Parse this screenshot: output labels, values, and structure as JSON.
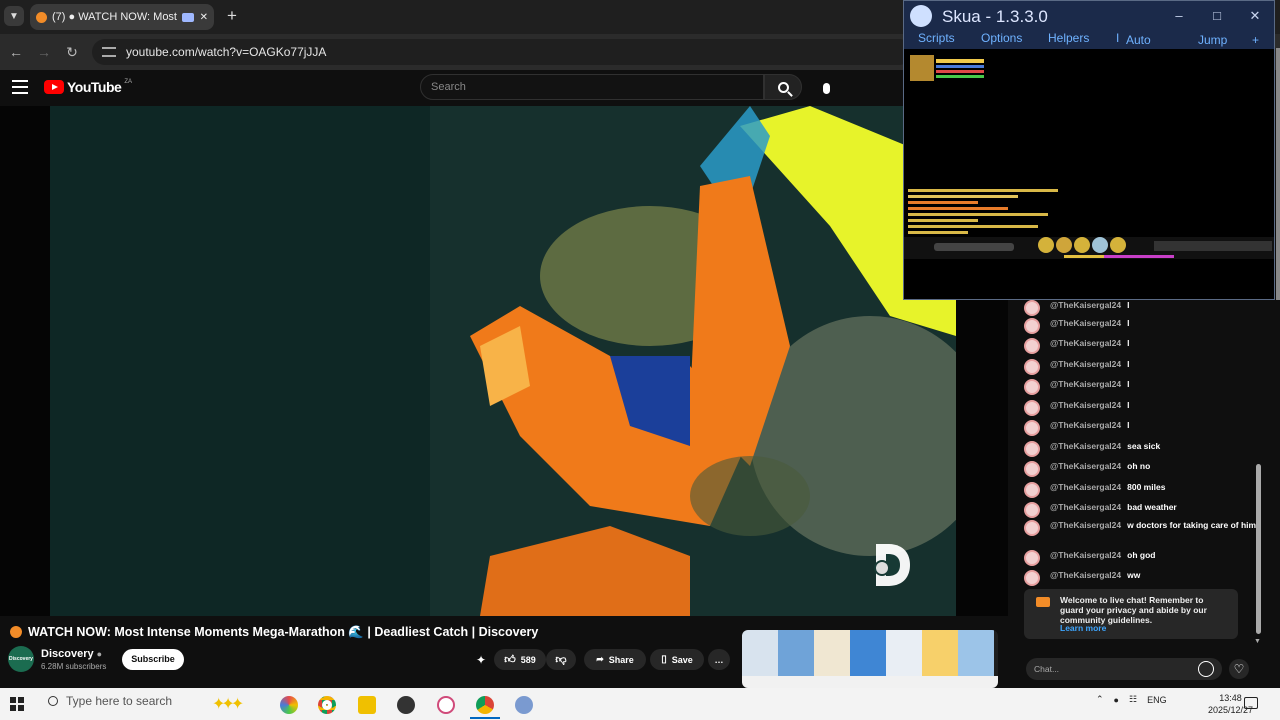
{
  "browser": {
    "tab": {
      "title": "(7) ● WATCH NOW: Most ",
      "close": "✕"
    },
    "new_tab": "+",
    "url": "youtube.com/watch?v=OAGKo77jJJA"
  },
  "youtube": {
    "logo_text": "YouTube",
    "region": "ZA",
    "search_placeholder": "Search"
  },
  "video": {
    "title": "WATCH NOW: Most Intense Moments Mega-Marathon 🌊 | Deadliest Catch | Discovery",
    "channel": "Discovery",
    "channel_avatar_text": "Discovery",
    "subscribers": "6.28M subscribers",
    "subscribe_label": "Subscribe",
    "likes": "589",
    "share_label": "Share",
    "save_label": "Save",
    "more_label": "…"
  },
  "chat": {
    "messages": [
      {
        "author": "@TheKaisergal24",
        "text": "l"
      },
      {
        "author": "@TheKaisergal24",
        "text": "l"
      },
      {
        "author": "@TheKaisergal24",
        "text": "l"
      },
      {
        "author": "@TheKaisergal24",
        "text": "l"
      },
      {
        "author": "@TheKaisergal24",
        "text": "l"
      },
      {
        "author": "@TheKaisergal24",
        "text": "l"
      },
      {
        "author": "@TheKaisergal24",
        "text": "l"
      },
      {
        "author": "@TheKaisergal24",
        "text": "sea sick"
      },
      {
        "author": "@TheKaisergal24",
        "text": "oh no"
      },
      {
        "author": "@TheKaisergal24",
        "text": "800 miles"
      },
      {
        "author": "@TheKaisergal24",
        "text": "bad weather"
      },
      {
        "author": "@TheKaisergal24",
        "text": "w doctors for taking care of him"
      },
      {
        "author": "@TheKaisergal24",
        "text": "oh god"
      },
      {
        "author": "@TheKaisergal24",
        "text": "ww"
      }
    ],
    "welcome_text": "Welcome to live chat! Remember to guard your privacy and abide by our community guidelines.",
    "learn_more": "Learn more",
    "input_placeholder": "Chat..."
  },
  "skua": {
    "title": "Skua - 1.3.3.0",
    "menu": [
      "Scripts",
      "Options",
      "Helpers",
      "I",
      "Auto",
      "Jump",
      "+"
    ]
  },
  "taskbar": {
    "search_placeholder": "Type here to search",
    "language": "ENG",
    "time": "13:48",
    "date": "2025/12/27"
  },
  "colors": {
    "youtube_red": "#ff0000",
    "live_orange": "#f28c28",
    "link_blue": "#3ea6ff",
    "skua_blue": "#6fb2ff"
  }
}
